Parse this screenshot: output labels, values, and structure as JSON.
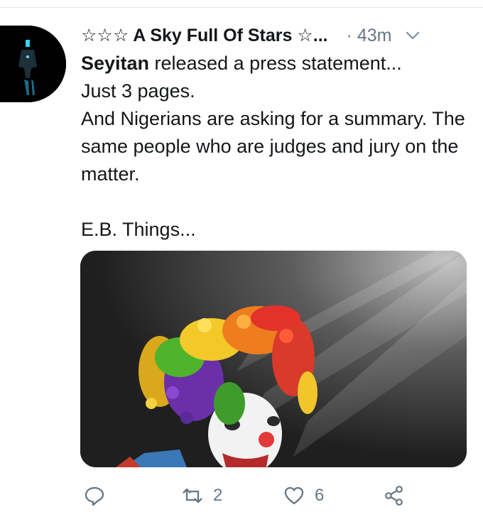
{
  "tweet": {
    "display_name": "☆☆☆ A Sky Full Of Stars ☆...",
    "timestamp": "· 43m",
    "mention": "Seyitan",
    "line1_rest": " released a press statement...",
    "line2": "Just 3 pages.",
    "line3": "And Nigerians are asking for a summary. The same people who are judges and jury on the matter.",
    "line4": "E.B. Things..."
  },
  "actions": {
    "reply_icon": "reply-icon",
    "retweet_icon": "retweet-icon",
    "retweet_count": "2",
    "like_icon": "heart-icon",
    "like_count": "6",
    "share_icon": "share-icon"
  },
  "colors": {
    "text": "#14171a",
    "muted": "#657786",
    "divider": "#e1e8ed"
  }
}
